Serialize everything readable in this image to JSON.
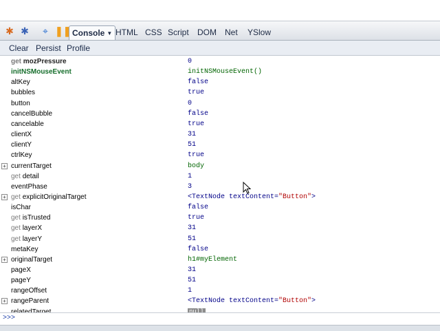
{
  "toolbar": {
    "tabs": [
      {
        "label": "Console",
        "active": true
      },
      {
        "label": "HTML"
      },
      {
        "label": "CSS"
      },
      {
        "label": "Script"
      },
      {
        "label": "DOM"
      },
      {
        "label": "Net"
      },
      {
        "label": "YSlow"
      }
    ],
    "icons": [
      "firebug-bug-icon",
      "firebug-bug-blue-icon",
      "inspect-icon",
      "pause-icon"
    ]
  },
  "subtoolbar": {
    "clear": "Clear",
    "persist": "Persist",
    "profile": "Profile"
  },
  "rows": [
    {
      "getter": "get",
      "name": "mozPressure",
      "value": "0",
      "style": "bold",
      "type": "num"
    },
    {
      "getter": "",
      "name": "initNSMouseEvent",
      "value": "initNSMouseEvent()",
      "style": "green",
      "type": "fn"
    },
    {
      "getter": "",
      "name": "altKey",
      "value": "false",
      "type": "bool"
    },
    {
      "getter": "",
      "name": "bubbles",
      "value": "true",
      "type": "bool"
    },
    {
      "getter": "",
      "name": "button",
      "value": "0",
      "type": "num"
    },
    {
      "getter": "",
      "name": "cancelBubble",
      "value": "false",
      "type": "bool"
    },
    {
      "getter": "",
      "name": "cancelable",
      "value": "true",
      "type": "bool"
    },
    {
      "getter": "",
      "name": "clientX",
      "value": "31",
      "type": "num"
    },
    {
      "getter": "",
      "name": "clientY",
      "value": "51",
      "type": "num"
    },
    {
      "getter": "",
      "name": "ctrlKey",
      "value": "true",
      "type": "bool"
    },
    {
      "getter": "",
      "name": "currentTarget",
      "value": "body",
      "type": "obj",
      "expandable": true
    },
    {
      "getter": "get",
      "name": "detail",
      "value": "1",
      "type": "num"
    },
    {
      "getter": "",
      "name": "eventPhase",
      "value": "3",
      "type": "num"
    },
    {
      "getter": "get",
      "name": "explicitOriginalTarget",
      "value_prefix": "<TextNode textContent=",
      "value_str": "\"Button\"",
      "value_suffix": ">",
      "type": "node",
      "expandable": true
    },
    {
      "getter": "",
      "name": "isChar",
      "value": "false",
      "type": "bool"
    },
    {
      "getter": "get",
      "name": "isTrusted",
      "value": "true",
      "type": "bool"
    },
    {
      "getter": "get",
      "name": "layerX",
      "value": "31",
      "type": "num"
    },
    {
      "getter": "get",
      "name": "layerY",
      "value": "51",
      "type": "num"
    },
    {
      "getter": "",
      "name": "metaKey",
      "value": "false",
      "type": "bool"
    },
    {
      "getter": "",
      "name": "originalTarget",
      "value": "h1#myElement",
      "type": "obj",
      "expandable": true
    },
    {
      "getter": "",
      "name": "pageX",
      "value": "31",
      "type": "num"
    },
    {
      "getter": "",
      "name": "pageY",
      "value": "51",
      "type": "num"
    },
    {
      "getter": "",
      "name": "rangeOffset",
      "value": "1",
      "type": "num"
    },
    {
      "getter": "",
      "name": "rangeParent",
      "value_prefix": "<TextNode textContent=",
      "value_str": "\"Button\"",
      "value_suffix": ">",
      "type": "node",
      "expandable": true
    },
    {
      "getter": "",
      "name": "relatedTarget",
      "value": "null",
      "type": "null"
    }
  ],
  "commandline": {
    "prompt": ">>>"
  }
}
